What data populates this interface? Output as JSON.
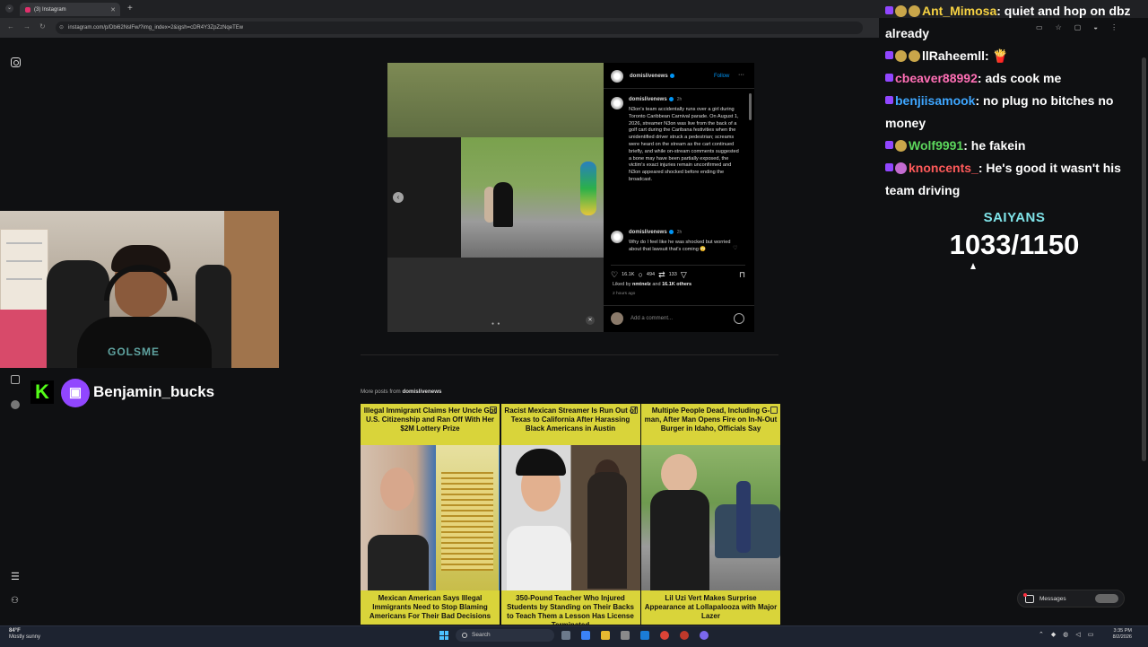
{
  "browser": {
    "tab_title": "(3) Instagram",
    "new_tab": "+",
    "tab_close": "✕",
    "url": "instagram.com/p/Dbi62NslFw/?img_index=2&igsh=cDR4Y3ZpZzNqeTEw"
  },
  "post": {
    "account": "domislivenews",
    "follow_label": "Follow",
    "more_label": "···",
    "caption_time": "2h",
    "caption": "N3on's team accidentally runs over a girl during Toronto Caribbean Carnival parade. On August 1, 2026, streamer N3on was live from the back of a golf cart during the Caribana festivities when the unidentified driver struck a pedestrian; screams were heard on the stream as the cart continued briefly, and while on-stream comments suggested a bone may have been partially exposed, the victim's exact injuries remain unconfirmed and N3on appeared shocked before ending the broadcast.",
    "comment_user": "domislivenews",
    "comment_time": "2h",
    "comment_text": "Why do I feel like he was shocked but worried about that lawsuit that's coming 😳",
    "likes": "16.1K",
    "comments": "494",
    "shares": "133",
    "liked_by_prefix": "Liked by",
    "liked_by_user": "nmtnelz",
    "liked_by_mid": "and",
    "liked_by_others": "16.1K others",
    "posted_ago": "2 hours ago",
    "add_comment_placeholder": "Add a comment..."
  },
  "more_posts": {
    "label": "More posts from",
    "account": "domislivenews",
    "cards": [
      {
        "title": "Illegal Immigrant Claims Her Uncle Got U.S. Citizenship and Ran Off With Her $2M Lottery Prize"
      },
      {
        "title": "Racist Mexican Streamer Is Run Out of Texas to California After Harassing Black Americans in Austin"
      },
      {
        "title": "Multiple People Dead, Including G-man, After Man Opens Fire on In-N-Out Burger in Idaho, Officials Say"
      },
      {
        "title": "Mexican American Says Illegal Immigrants Need to Stop Blaming Americans For Their Bad Decisions"
      },
      {
        "title": "350-Pound Teacher Who Injured Students by Standing on Their Backs to Teach Them a Lesson Has License Terminated"
      },
      {
        "title": "Lil Uzi Vert Makes Surprise Appearance at Lollapalooza with Major Lazer"
      }
    ]
  },
  "stream": {
    "kick_logo": "K",
    "streamer_name": "Benjamin_bucks",
    "cam_shirt_text": "GOLSME",
    "goal_title": "SAIYANS",
    "goal_progress": "1033/1150"
  },
  "chat": [
    {
      "user": "Ant_Mimosa",
      "color": "#f5d142",
      "text": "quiet and hop on dbz already"
    },
    {
      "user": "llRaheemll",
      "color": "#ffffff",
      "text": "🍟"
    },
    {
      "user": "cbeaver88992",
      "color": "#ff6fb5",
      "text": "ads cook me"
    },
    {
      "user": "benjiisamook",
      "color": "#3ea6ff",
      "text": "no plug no bitches no money"
    },
    {
      "user": "Wolf9991",
      "color": "#5cd65c",
      "text": "he fakein"
    },
    {
      "user": "knoncents_",
      "color": "#ff5a5a",
      "text": "He's good it wasn't his team driving"
    }
  ],
  "messages_pill": {
    "label": "Messages"
  },
  "taskbar": {
    "temp": "84°F",
    "weather": "Mostly sunny",
    "search": "Search",
    "time": "3:35 PM",
    "date": "8/2/2026"
  },
  "colors": {
    "accent": "#0095f6",
    "twitch": "#9146ff",
    "kick": "#53fc18",
    "goal": "#7fe3e8"
  }
}
